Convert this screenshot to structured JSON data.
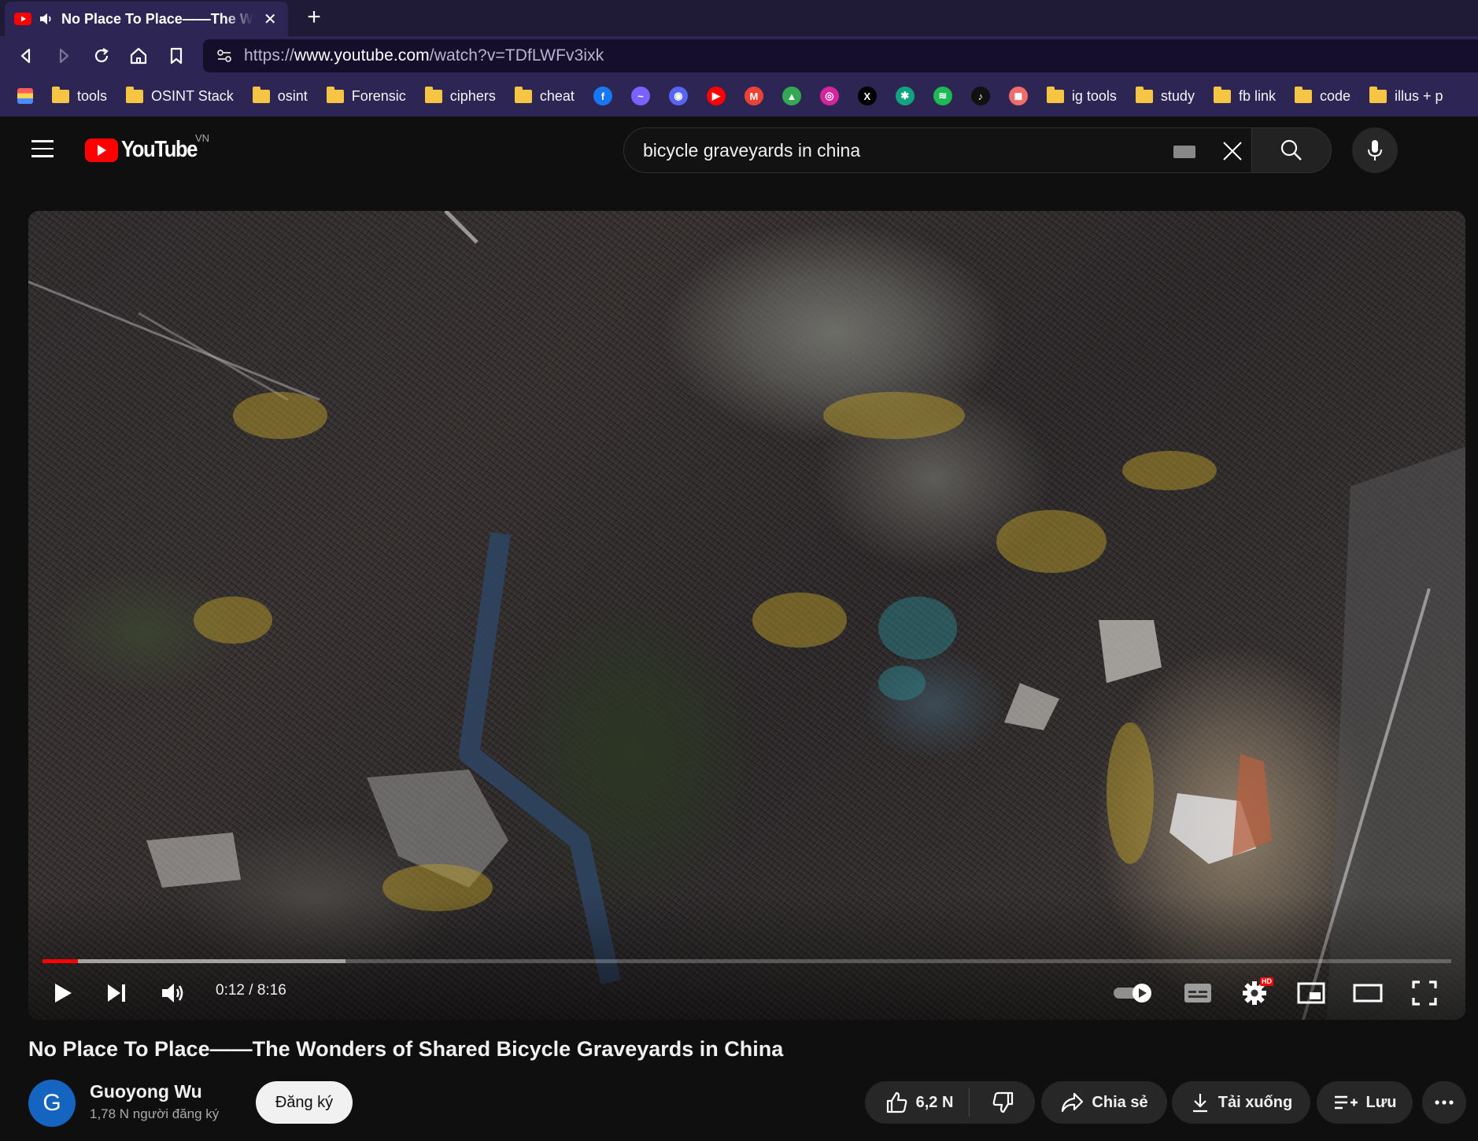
{
  "browser": {
    "tab": {
      "title": "No Place To Place——The Wonders of Shared Bicycle Graveyards in China",
      "close": "✕"
    },
    "new_tab": "+",
    "url": {
      "scheme": "https://",
      "host": "www.youtube.com",
      "path": "/watch?v=TDfLWFv3ixk"
    },
    "bookmarks": [
      {
        "type": "folder",
        "label": "tools"
      },
      {
        "type": "folder",
        "label": "OSINT Stack"
      },
      {
        "type": "folder",
        "label": "osint"
      },
      {
        "type": "folder",
        "label": "Forensic"
      },
      {
        "type": "folder",
        "label": "ciphers"
      },
      {
        "type": "folder",
        "label": "cheat"
      },
      {
        "type": "icon",
        "icon": "facebook-icon",
        "color": "#1877f2",
        "glyph": "f"
      },
      {
        "type": "icon",
        "icon": "messenger-icon",
        "color": "#7b61ff",
        "glyph": "~"
      },
      {
        "type": "icon",
        "icon": "discord-icon",
        "color": "#5865f2",
        "glyph": "◉"
      },
      {
        "type": "icon",
        "icon": "youtube-icon",
        "color": "#ff0000",
        "glyph": "▶"
      },
      {
        "type": "icon",
        "icon": "gmail-icon",
        "color": "#ea4335",
        "glyph": "M"
      },
      {
        "type": "icon",
        "icon": "google-drive-icon",
        "color": "#34a853",
        "glyph": "▲"
      },
      {
        "type": "icon",
        "icon": "instagram-icon",
        "color": "#d6249f",
        "glyph": "◎"
      },
      {
        "type": "icon",
        "icon": "x-icon",
        "color": "#000000",
        "glyph": "X"
      },
      {
        "type": "icon",
        "icon": "chatgpt-icon",
        "color": "#10a37f",
        "glyph": "✱"
      },
      {
        "type": "icon",
        "icon": "spotify-icon",
        "color": "#1db954",
        "glyph": "≋"
      },
      {
        "type": "icon",
        "icon": "tiktok-icon",
        "color": "#111111",
        "glyph": "♪"
      },
      {
        "type": "icon",
        "icon": "app-icon",
        "color": "#f26b6b",
        "glyph": "◼"
      },
      {
        "type": "folder",
        "label": "ig tools"
      },
      {
        "type": "folder",
        "label": "study"
      },
      {
        "type": "folder",
        "label": "fb link"
      },
      {
        "type": "folder",
        "label": "code"
      },
      {
        "type": "folder",
        "label": "illus + p"
      }
    ]
  },
  "youtube": {
    "logo_text": "YouTube",
    "country_code": "VN",
    "search_value": "bicycle graveyards in china"
  },
  "player": {
    "time": "0:12 / 8:16",
    "progress": {
      "played_fraction": 0.025,
      "buffered_fraction": 0.215
    },
    "hd_badge": "HD"
  },
  "video": {
    "title": "No Place To Place——The Wonders of Shared Bicycle Graveyards in China",
    "channel": {
      "avatar_letter": "G",
      "name": "Guoyong Wu",
      "subscribers": "1,78 N người đăng ký"
    },
    "subscribe_label": "Đăng ký",
    "likes": "6,2 N",
    "share_label": "Chia sẻ",
    "download_label": "Tải xuống",
    "save_label": "Lưu"
  },
  "colors": {
    "brand": "#ff0000",
    "browser_chrome": "#2d2554",
    "page_bg": "#0f0f0f"
  }
}
